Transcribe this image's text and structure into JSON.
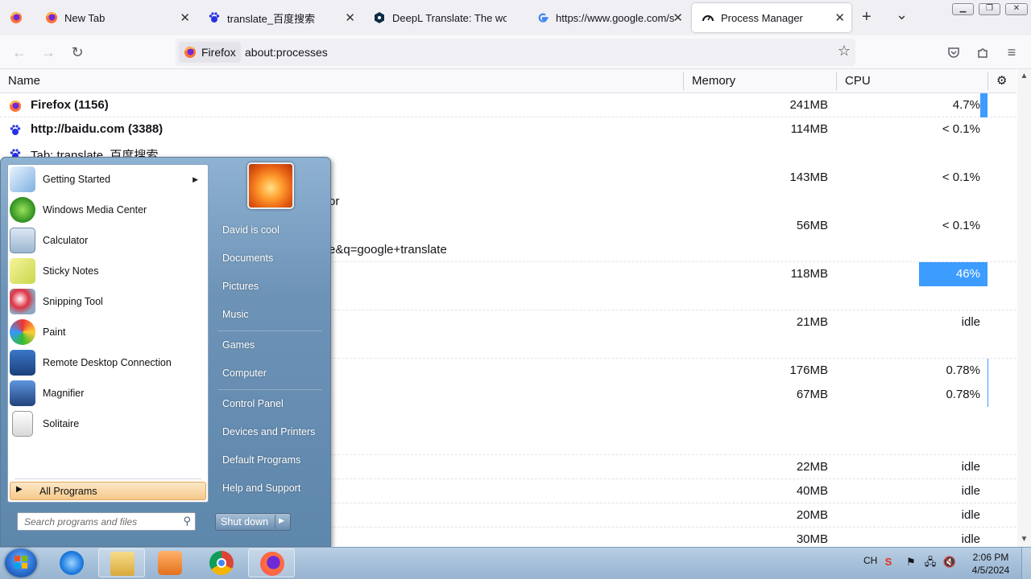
{
  "browser": {
    "tabs": [
      {
        "label": "",
        "icon": "firefox-icon"
      },
      {
        "label": "New Tab",
        "icon": "firefox-icon"
      },
      {
        "label": "translate_百度搜索",
        "icon": "baidu-paw-icon"
      },
      {
        "label": "DeepL Translate: The world",
        "icon": "deepl-icon"
      },
      {
        "label": "https://www.google.com/s",
        "icon": "google-icon"
      },
      {
        "label": "Process Manager",
        "icon": "gauge-icon"
      }
    ],
    "new_tab_glyph": "+",
    "tab_list_glyph": "⌄",
    "close_glyph": "✕",
    "identity_label": "Firefox",
    "url": "about:processes"
  },
  "processes": {
    "columns": {
      "name": "Name",
      "memory": "Memory",
      "cpu": "CPU"
    },
    "rows": [
      {
        "name": "Firefox (1156)",
        "memory": "241MB",
        "cpu": "4.7%",
        "bold": true,
        "icon": "firefox-icon",
        "cpu_fraction": 0.047
      },
      {
        "name": "http://baidu.com (3388)",
        "memory": "114MB",
        "cpu": "< 0.1%",
        "bold": true,
        "icon": "baidu-paw-icon"
      },
      {
        "name": "Tab: translate_百度搜索",
        "memory": "",
        "cpu": "",
        "bold": false,
        "icon": "baidu-paw-icon"
      },
      {
        "name": "",
        "memory": "143MB",
        "cpu": "< 0.1%"
      },
      {
        "name": "or",
        "memory": "",
        "cpu": ""
      },
      {
        "name": "",
        "memory": "56MB",
        "cpu": "< 0.1%"
      },
      {
        "name": "e&q=google+translate",
        "memory": "",
        "cpu": ""
      },
      {
        "name": "",
        "memory": "118MB",
        "cpu": "46%",
        "cpu_fraction": 0.46
      },
      {
        "name": "",
        "memory": "",
        "cpu": ""
      },
      {
        "name": "",
        "memory": "21MB",
        "cpu": "idle"
      },
      {
        "name": "",
        "memory": "",
        "cpu": ""
      },
      {
        "name": "",
        "memory": "176MB",
        "cpu": "0.78%"
      },
      {
        "name": "",
        "memory": "67MB",
        "cpu": "0.78%"
      },
      {
        "name": "",
        "memory": "",
        "cpu": ""
      },
      {
        "name": "",
        "memory": "",
        "cpu": ""
      },
      {
        "name": "",
        "memory": "22MB",
        "cpu": "idle"
      },
      {
        "name": "",
        "memory": "40MB",
        "cpu": "idle"
      },
      {
        "name": "",
        "memory": "20MB",
        "cpu": "idle"
      },
      {
        "name": "",
        "memory": "30MB",
        "cpu": "idle"
      }
    ],
    "settings_glyph": "⚙"
  },
  "start_menu": {
    "programs": [
      {
        "label": "Getting Started",
        "icon": "getting-started-icon",
        "submenu": true
      },
      {
        "label": "Windows Media Center",
        "icon": "media-center-icon"
      },
      {
        "label": "Calculator",
        "icon": "calculator-icon"
      },
      {
        "label": "Sticky Notes",
        "icon": "sticky-notes-icon"
      },
      {
        "label": "Snipping Tool",
        "icon": "snipping-tool-icon"
      },
      {
        "label": "Paint",
        "icon": "paint-icon"
      },
      {
        "label": "Remote Desktop Connection",
        "icon": "remote-desktop-icon"
      },
      {
        "label": "Magnifier",
        "icon": "magnifier-icon"
      },
      {
        "label": "Solitaire",
        "icon": "solitaire-icon"
      }
    ],
    "all_programs": "All Programs",
    "search_placeholder": "Search programs and files",
    "right_items": [
      "David is cool",
      "Documents",
      "Pictures",
      "Music",
      "Games",
      "Computer",
      "Control Panel",
      "Devices and Printers",
      "Default Programs",
      "Help and Support"
    ],
    "shutdown_label": "Shut down"
  },
  "taskbar": {
    "apps": [
      "internet-explorer-icon",
      "windows-explorer-icon",
      "media-player-icon",
      "chrome-icon",
      "firefox-icon"
    ],
    "language": "CH",
    "time": "2:06 PM",
    "date": "4/5/2024"
  },
  "colors": {
    "accent_blue": "#3d9cff",
    "all_programs_orange": "#f6c98a"
  }
}
